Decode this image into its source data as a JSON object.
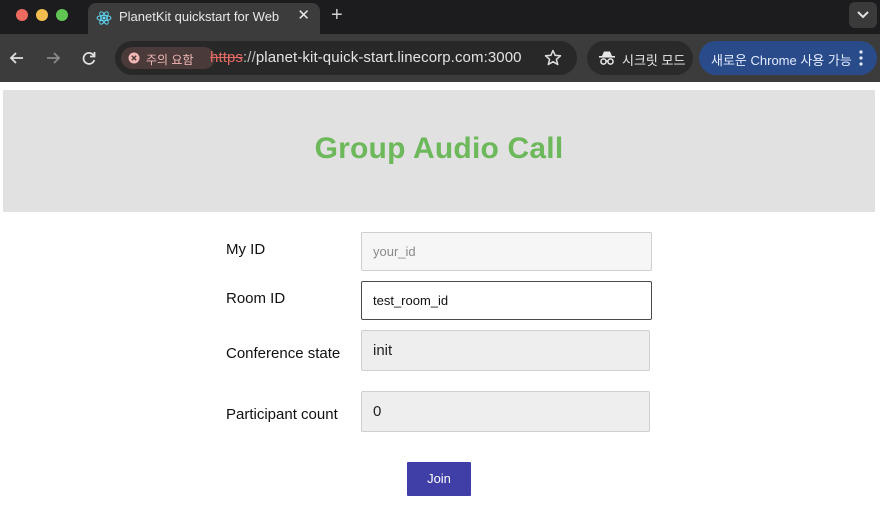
{
  "window": {
    "tab_title": "PlanetKit quickstart for Web",
    "tab_close": "✕",
    "new_tab": "+"
  },
  "toolbar": {
    "security_label": "주의 요함",
    "url_scheme": "https",
    "url_sep": "://",
    "url_host": "planet-kit-quick-start.linecorp.com:3000",
    "incognito_label": "시크릿 모드",
    "update_label": "새로운 Chrome 사용 가능"
  },
  "page": {
    "title": "Group Audio Call",
    "fields": {
      "my_id_label": "My ID",
      "my_id_placeholder": "your_id",
      "room_id_label": "Room ID",
      "room_id_value": "test_room_id",
      "conference_state_label": "Conference state",
      "conference_state_value": "init",
      "participant_count_label": "Participant count",
      "participant_count_value": "0"
    },
    "join_label": "Join"
  },
  "colors": {
    "title_green": "#6db85a",
    "join_button": "#3f3fa7",
    "header_bg": "#e1e1e1"
  }
}
